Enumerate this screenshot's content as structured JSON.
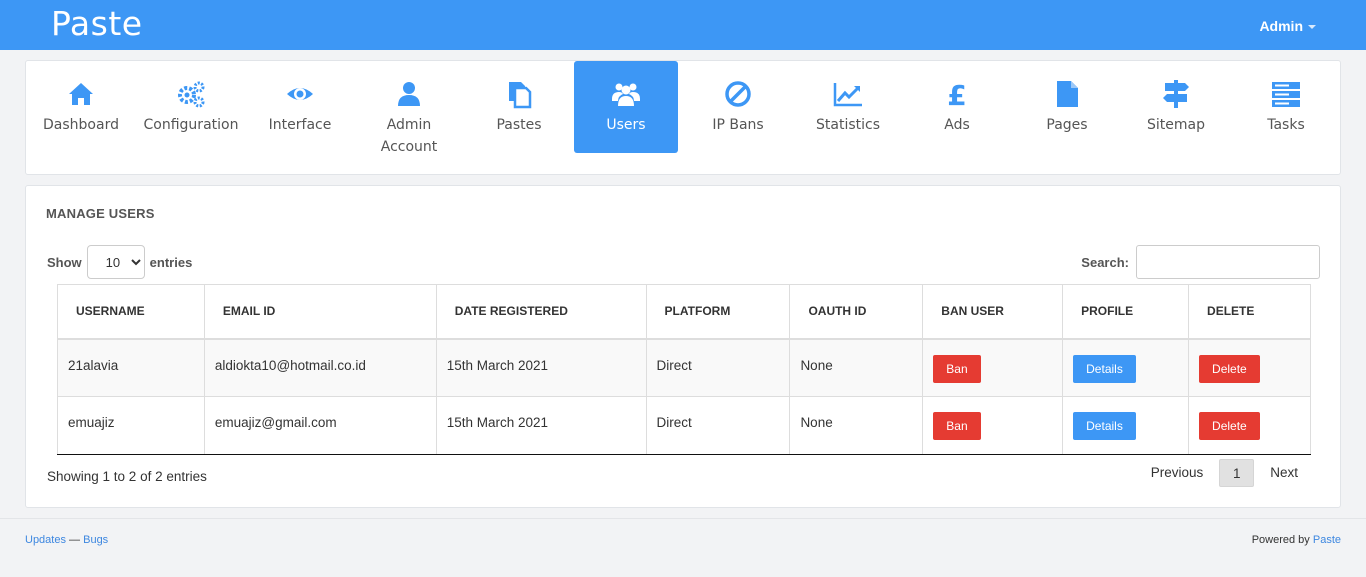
{
  "app": {
    "title": "Paste",
    "user_menu": "Admin"
  },
  "colors": {
    "primary": "#3d97f5",
    "danger": "#e53b32",
    "icon": "#3d97f5"
  },
  "nav": [
    {
      "label": "Dashboard",
      "icon": "home-icon"
    },
    {
      "label": "Configuration",
      "icon": "gears-icon"
    },
    {
      "label": "Interface",
      "icon": "eye-icon"
    },
    {
      "label": "Admin Account",
      "icon": "user-icon"
    },
    {
      "label": "Pastes",
      "icon": "files-icon"
    },
    {
      "label": "Users",
      "icon": "users-icon",
      "active": true
    },
    {
      "label": "IP Bans",
      "icon": "ban-icon"
    },
    {
      "label": "Statistics",
      "icon": "line-chart-icon"
    },
    {
      "label": "Ads",
      "icon": "pound-icon"
    },
    {
      "label": "Pages",
      "icon": "file-icon"
    },
    {
      "label": "Sitemap",
      "icon": "signpost-icon"
    },
    {
      "label": "Tasks",
      "icon": "server-icon"
    }
  ],
  "manage": {
    "title": "MANAGE USERS",
    "show_label": "Show",
    "entries_label": "entries",
    "length_value": "10",
    "search_label": "Search:",
    "search_value": ""
  },
  "table": {
    "headers": [
      "USERNAME",
      "EMAIL ID",
      "DATE REGISTERED",
      "PLATFORM",
      "OAUTH ID",
      "BAN USER",
      "PROFILE",
      "DELETE"
    ],
    "rows": [
      {
        "username": "21alavia",
        "email": "aldiokta10@hotmail.co.id",
        "date": "15th March 2021",
        "platform": "Direct",
        "oauth": "None",
        "ban": "Ban",
        "profile": "Details",
        "delete": "Delete"
      },
      {
        "username": "emuajiz",
        "email": "emuajiz@gmail.com",
        "date": "15th March 2021",
        "platform": "Direct",
        "oauth": "None",
        "ban": "Ban",
        "profile": "Details",
        "delete": "Delete"
      }
    ]
  },
  "pagination": {
    "info": "Showing 1 to 2 of 2 entries",
    "previous": "Previous",
    "current": "1",
    "next": "Next"
  },
  "footer": {
    "updates": "Updates",
    "separator": " — ",
    "bugs": "Bugs",
    "powered_by": "Powered by ",
    "powered_link": "Paste"
  }
}
